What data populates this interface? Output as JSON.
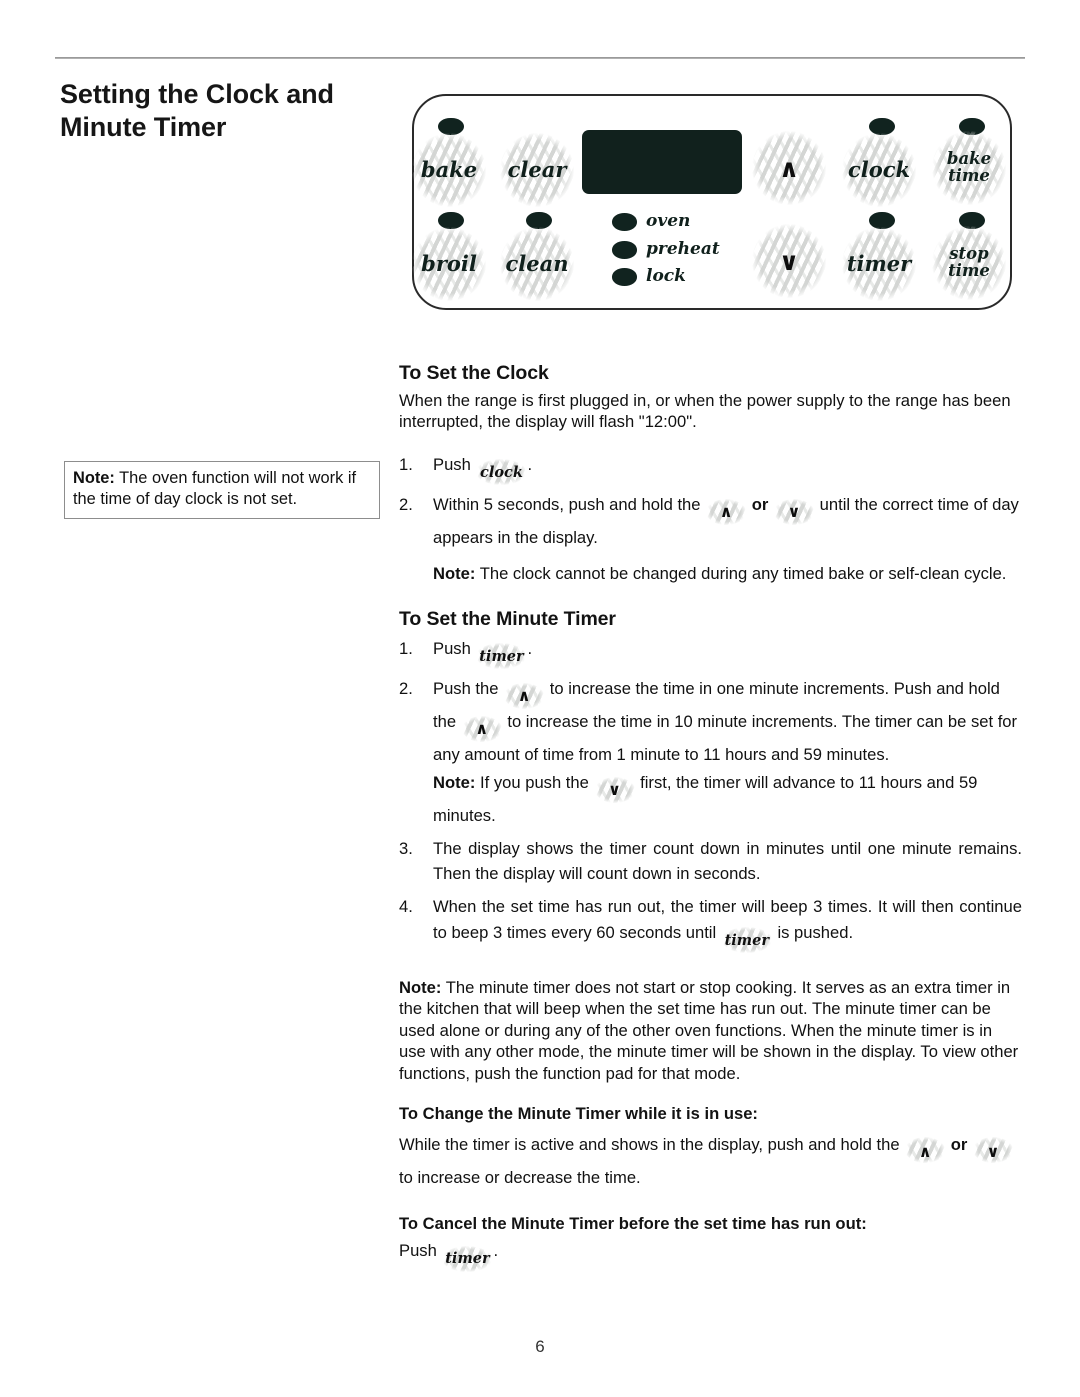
{
  "page": {
    "title_line1": "Setting the Clock and",
    "title_line2": "Minute Timer",
    "number": "6"
  },
  "side_note": {
    "label": "Note:",
    "text": " The oven function will not work if the time of day clock is not set."
  },
  "control_panel": {
    "pads": [
      {
        "name": "bake",
        "label": "bake"
      },
      {
        "name": "clear",
        "label": "clear"
      },
      {
        "name": "up-arrow",
        "label": "∧"
      },
      {
        "name": "clock",
        "label": "clock"
      },
      {
        "name": "bake-time",
        "label": "bake\ntime"
      },
      {
        "name": "broil",
        "label": "broil"
      },
      {
        "name": "clean",
        "label": "clean"
      },
      {
        "name": "down-arrow",
        "label": "∨"
      },
      {
        "name": "timer",
        "label": "timer"
      },
      {
        "name": "stop-time",
        "label": "stop\ntime"
      }
    ],
    "indicators": [
      {
        "name": "oven",
        "label": "oven"
      },
      {
        "name": "preheat",
        "label": "preheat"
      },
      {
        "name": "lock",
        "label": "lock"
      }
    ],
    "display_value": ""
  },
  "sections": {
    "clock": {
      "heading": "To Set the Clock",
      "intro": "When the range is first plugged in, or when the power supply to the range has been interrupted, the display will flash \"12:00\".",
      "step1_pre": "Push",
      "step1_btn": "clock",
      "step1_post": ".",
      "step1_num": "1.",
      "step2_num": "2.",
      "step2_pre": "Within 5 seconds, push and hold the",
      "step2_btn_up": "∧",
      "step2_or": "or",
      "step2_btn_down": "∨",
      "step2_post": "until the correct time of day appears in the display.",
      "note_label": "Note:",
      "note_text": " The clock cannot be changed during any timed bake or self-clean cycle."
    },
    "minute_timer": {
      "heading": "To Set the Minute Timer",
      "step1_num": "1.",
      "step1_pre": "Push",
      "step1_btn": "timer",
      "step1_post": ".",
      "step2_num": "2.",
      "step2_a": "Push the",
      "step2_btn_up1": "∧",
      "step2_b": "to increase the time in one minute increments.  Push and hold the",
      "step2_btn_up2": "∧",
      "step2_c": "to increase the time in 10 minute increments. The timer can be set for any amount of time from 1 minute to 11 hours and 59 minutes.",
      "step2_note_label": "Note:",
      "step2_note_a": " If you push the",
      "step2_note_btn": "∨",
      "step2_note_b": "first, the timer will advance to 11 hours and 59 minutes.",
      "step3_num": "3.",
      "step3_text": "The display shows the timer count down in minutes until one minute remains. Then the display will count down in seconds.",
      "step4_num": "4.",
      "step4_a": "When the set time has run out, the timer will beep 3 times. It will then continue to beep 3 times every 60 seconds until",
      "step4_btn": "timer",
      "step4_b": "is pushed.",
      "note_label": "Note:",
      "note_text": "  The minute timer does not start or stop cooking. It serves as an extra timer in the kitchen that will beep when the set time has run out. The minute timer can be used alone or during any of the other oven functions. When the minute timer is in use with any other mode, the minute timer will be shown in the display. To view other functions, push the function pad for that mode."
    },
    "change_timer": {
      "heading": "To Change the Minute Timer while it is in use:",
      "text_a": "While the timer is active and shows in the display, push and hold the",
      "btn_up": "∧",
      "or": "or",
      "btn_down": "∨",
      "text_b": "to increase or decrease the time."
    },
    "cancel_timer": {
      "heading": "To Cancel the Minute Timer before the set time has run out:",
      "push": "Push",
      "btn": "timer",
      "post": "."
    }
  }
}
